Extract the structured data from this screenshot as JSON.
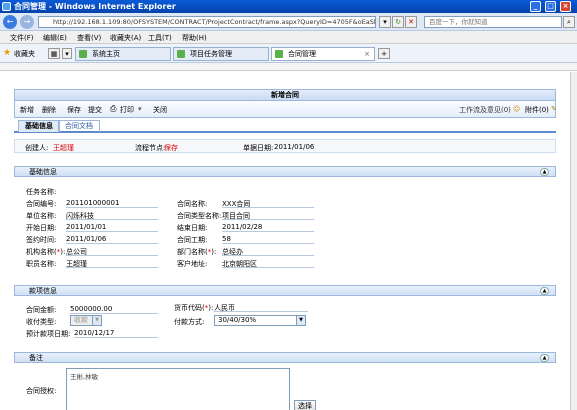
{
  "window": {
    "title": "合同管理 - Windows Internet Explorer",
    "minimize": "_",
    "maximize": "□",
    "close": "×"
  },
  "browser": {
    "back": "←",
    "forward": "→",
    "url": "http://192.168.1.109:80/OFSYSTEM/CONTRACT/ProjectContract/frame.aspx?QueryID=4705F&oEaSbc",
    "search_placeholder": "百度一下，你就知道",
    "menu": [
      "文件(F)",
      "编辑(E)",
      "查看(V)",
      "收藏夹(A)",
      "工具(T)",
      "帮助(H)"
    ],
    "favorites_label": "收藏夹",
    "tabs": [
      {
        "label": "系统主页",
        "active": false
      },
      {
        "label": "项目任务管理",
        "active": false
      },
      {
        "label": "合同管理",
        "active": true
      }
    ]
  },
  "form": {
    "title": "新增合同",
    "toolbar": {
      "new": "新增",
      "delete": "删除",
      "save": "保存",
      "submit": "提交",
      "print": "打印",
      "close": "关闭",
      "workflow": "工作流及意见(0)",
      "attachment": "附件(0)"
    },
    "tabs": [
      "基础信息",
      "合同文档"
    ],
    "info": {
      "creator_label": "创建人:",
      "creator": "王超瑾",
      "node_label": "流程节点:",
      "node": "保存",
      "date_label": "单据日期:",
      "date": "2011/01/06"
    },
    "basic": {
      "heading": "基础信息",
      "task_label": "任务名称:",
      "contract_no_label": "合同编号:",
      "contract_no": "201101000001",
      "contract_name_label": "合同名称:",
      "contract_name": "XXX合同",
      "unit_label": "单位名称:",
      "unit": "闪烁科技",
      "type_label": "合同类型名称:",
      "type": "项目合同",
      "start_label": "开始日期:",
      "start": "2011/01/01",
      "end_label": "结束日期:",
      "end": "2011/02/28",
      "sign_label": "签约时间:",
      "sign": "2011/01/06",
      "period_label": "合同工期:",
      "period": "58",
      "org_label_pre": "机构名称(",
      "org_star": "*",
      "org_label_post": "):",
      "org": "总公司",
      "dept_label_pre": "部门名称(",
      "dept_star": "*",
      "dept_label_post": "):",
      "dept": "总经办",
      "staff_label": "职员名称:",
      "staff": "王超瑾",
      "customer_label": "客户地址:",
      "customer": "北京朝阳区"
    },
    "payment": {
      "heading": "款项信息",
      "amount_label": "合同金额:",
      "amount": "5000000.00",
      "currency_label_pre": "货币代码(",
      "currency_star": "*",
      "currency_label_post": "):",
      "currency": "人民币",
      "recv_type_label": "收付类型:",
      "recv_type": "收款",
      "pay_mode_label": "付款方式:",
      "pay_mode": "30/40/30%",
      "expected_label": "预计款项日期:",
      "expected": "2010/12/17"
    },
    "remark": {
      "heading": "备注",
      "auth_label": "合同授权:",
      "auth_text": "王彬,林敏",
      "select_btn": "选择"
    }
  },
  "colors": {
    "accent": "#5a8ad0",
    "required": "#dd0000"
  }
}
